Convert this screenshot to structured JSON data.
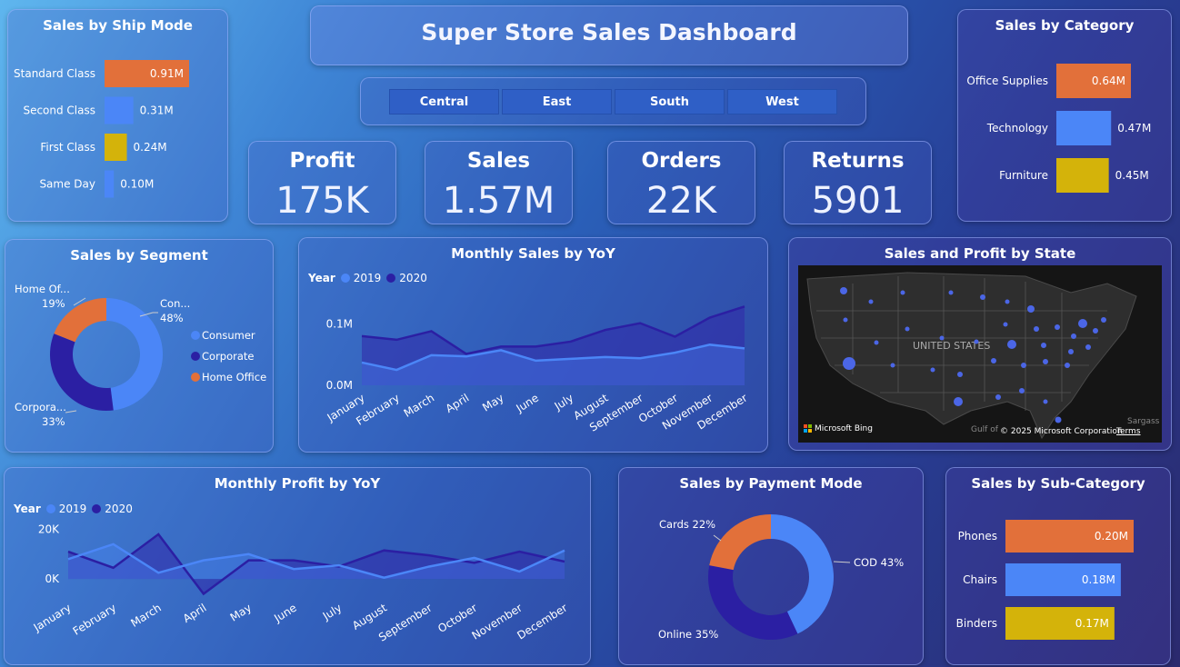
{
  "header": {
    "title": "Super Store Sales Dashboard"
  },
  "regions": [
    "Central",
    "East",
    "South",
    "West"
  ],
  "kpis": [
    {
      "label": "Profit",
      "value": "175K"
    },
    {
      "label": "Sales",
      "value": "1.57M"
    },
    {
      "label": "Orders",
      "value": "22K"
    },
    {
      "label": "Returns",
      "value": "5901"
    }
  ],
  "colors": {
    "orange": "#e2703a",
    "blue": "#4b86f7",
    "gold": "#d4b30a",
    "dark": "#2b1fa3"
  },
  "charts": {
    "ship_mode": {
      "title": "Sales by Ship Mode",
      "chart_data": {
        "type": "bar",
        "categories": [
          "Standard Class",
          "Second Class",
          "First Class",
          "Same Day"
        ],
        "values": [
          0.91,
          0.31,
          0.24,
          0.1
        ],
        "labels": [
          "0.91M",
          "0.31M",
          "0.24M",
          "0.10M"
        ],
        "colors": [
          "#e2703a",
          "#4b86f7",
          "#d4b30a",
          "#4b86f7"
        ]
      }
    },
    "category": {
      "title": "Sales by Category",
      "chart_data": {
        "type": "bar",
        "categories": [
          "Office Supplies",
          "Technology",
          "Furniture"
        ],
        "values": [
          0.64,
          0.47,
          0.45
        ],
        "labels": [
          "0.64M",
          "0.47M",
          "0.45M"
        ],
        "colors": [
          "#e2703a",
          "#4b86f7",
          "#d4b30a"
        ]
      }
    },
    "segment": {
      "title": "Sales by Segment",
      "chart_data": {
        "type": "pie",
        "categories": [
          "Consumer",
          "Corporate",
          "Home Office"
        ],
        "values": [
          48,
          33,
          19
        ],
        "outer_labels": [
          "Con...",
          "Corpora...",
          "Home Of..."
        ],
        "percent_labels": [
          "48%",
          "33%",
          "19%"
        ],
        "colors": [
          "#4b86f7",
          "#2b1fa3",
          "#e2703a"
        ]
      }
    },
    "monthly_sales": {
      "title": "Monthly Sales by YoY",
      "legend_title": "Year",
      "chart_data": {
        "type": "area",
        "categories": [
          "January",
          "February",
          "March",
          "April",
          "May",
          "June",
          "July",
          "August",
          "September",
          "October",
          "November",
          "December"
        ],
        "series": [
          {
            "name": "2019",
            "values": [
              0.037,
              0.025,
              0.049,
              0.047,
              0.057,
              0.04,
              0.043,
              0.046,
              0.044,
              0.053,
              0.066,
              0.06
            ]
          },
          {
            "name": "2020",
            "values": [
              0.08,
              0.074,
              0.088,
              0.051,
              0.063,
              0.063,
              0.071,
              0.09,
              0.101,
              0.079,
              0.11,
              0.128
            ]
          }
        ],
        "ylim": [
          0,
          0.13
        ],
        "yticks": [
          "0.0M",
          "0.1M"
        ],
        "ytick_values": [
          0,
          0.1
        ],
        "colors": [
          "#4b86f7",
          "#2b1fa3"
        ]
      }
    },
    "map": {
      "title": "Sales and Profit by State",
      "label": "UNITED STATES",
      "credit_brand": "Microsoft Bing",
      "credit_corp": "© 2025 Microsoft Corporation",
      "credit_terms": "Terms",
      "water_label": "Gulf of",
      "place_label": "Sargass"
    },
    "monthly_profit": {
      "title": "Monthly Profit by YoY",
      "legend_title": "Year",
      "chart_data": {
        "type": "area",
        "categories": [
          "January",
          "February",
          "March",
          "April",
          "May",
          "June",
          "July",
          "August",
          "September",
          "October",
          "November",
          "December"
        ],
        "series": [
          {
            "name": "2019",
            "values": [
              8000,
              14000,
              2500,
              7500,
              10000,
              4000,
              5500,
              500,
              5000,
              8500,
              3000,
              11500
            ]
          },
          {
            "name": "2020",
            "values": [
              11000,
              4500,
              18000,
              -6000,
              7500,
              7500,
              5000,
              11500,
              9500,
              6500,
              11000,
              7000
            ]
          }
        ],
        "ylim": [
          -8000,
          22000
        ],
        "yticks": [
          "0K",
          "20K"
        ],
        "ytick_values": [
          0,
          20000
        ],
        "colors": [
          "#4b86f7",
          "#2b1fa3"
        ]
      }
    },
    "payment": {
      "title": "Sales by Payment Mode",
      "chart_data": {
        "type": "pie",
        "categories": [
          "COD",
          "Online",
          "Cards"
        ],
        "values": [
          43,
          35,
          22
        ],
        "labels": [
          "COD 43%",
          "Online 35%",
          "Cards 22%"
        ],
        "colors": [
          "#4b86f7",
          "#2b1fa3",
          "#e2703a"
        ]
      }
    },
    "subcategory": {
      "title": "Sales by Sub-Category",
      "chart_data": {
        "type": "bar",
        "categories": [
          "Phones",
          "Chairs",
          "Binders"
        ],
        "values": [
          0.2,
          0.18,
          0.17
        ],
        "labels": [
          "0.20M",
          "0.18M",
          "0.17M"
        ],
        "colors": [
          "#e2703a",
          "#4b86f7",
          "#d4b30a"
        ]
      }
    }
  }
}
